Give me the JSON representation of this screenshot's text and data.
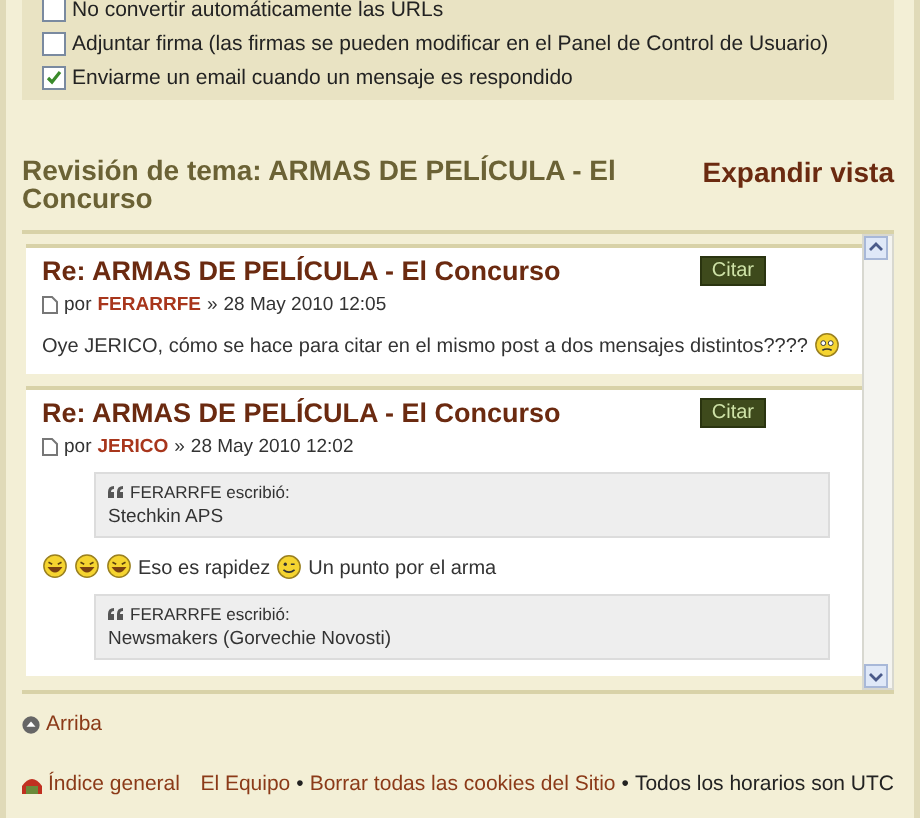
{
  "options": [
    {
      "label": "No convertir automáticamente las URLs",
      "checked": false
    },
    {
      "label": "Adjuntar firma (las firmas se pueden modificar en el Panel de Control de Usuario)",
      "checked": false
    },
    {
      "label": "Enviarme un email cuando un mensaje es respondido",
      "checked": true
    }
  ],
  "review": {
    "title": "Revisión de tema: ARMAS DE PELÍCULA - El Concurso",
    "expand_link": "Expandir vista",
    "posts": [
      {
        "title": "Re: ARMAS DE PELÍCULA - El Concurso",
        "quote_button": "Citar",
        "by": "por",
        "author": "FERARRFE",
        "separator": "»",
        "date": "28 May 2010 12:05",
        "body": [
          {
            "kind": "line",
            "parts": [
              {
                "kind": "text",
                "text": "Oye JERICO, cómo se hace para citar en el mismo post a dos mensajes distintos????"
              },
              {
                "kind": "confused"
              }
            ]
          }
        ]
      },
      {
        "title": "Re: ARMAS DE PELÍCULA - El Concurso",
        "quote_button": "Citar",
        "by": "por",
        "author": "JERICO",
        "separator": "»",
        "date": "28 May 2010 12:02",
        "body": [
          {
            "kind": "quote",
            "cite": "FERARRFE escribió:",
            "text": "Stechkin APS"
          },
          {
            "kind": "line",
            "parts": [
              {
                "kind": "laugh"
              },
              {
                "kind": "laugh"
              },
              {
                "kind": "laugh"
              },
              {
                "kind": "text",
                "text": "Eso es rapidez"
              },
              {
                "kind": "wink"
              },
              {
                "kind": "text",
                "text": "Un punto por el arma"
              }
            ]
          },
          {
            "kind": "quote",
            "cite": "FERARRFE escribió:",
            "text": "Newsmakers (Gorvechie Novosti)"
          }
        ]
      }
    ]
  },
  "top_link": "Arriba",
  "footer": {
    "index_link": "Índice general",
    "links": [
      {
        "text": "El Equipo",
        "kind": "link"
      },
      {
        "text": "•",
        "kind": "sep"
      },
      {
        "text": "Borrar todas las cookies del Sitio",
        "kind": "link"
      },
      {
        "text": "•",
        "kind": "sep"
      },
      {
        "text": "Todos los horarios son UTC",
        "kind": "text"
      }
    ]
  }
}
